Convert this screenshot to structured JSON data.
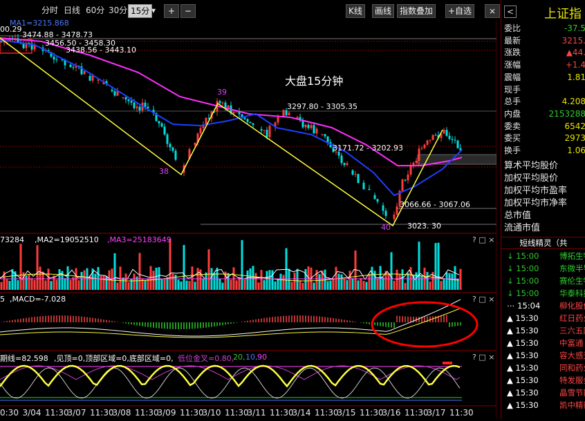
{
  "toolbar": {
    "tabs": [
      "分时",
      "日线",
      "60分",
      "30分",
      "15分"
    ],
    "active_tab": "15分",
    "dropdown_arrow": "▾",
    "zoom_in": "+",
    "zoom_out": "−",
    "right_buttons": [
      "K线",
      "画线",
      "指数叠加",
      "+自选"
    ],
    "close_label": "⨯"
  },
  "main_chart": {
    "ma_label": "MA1=3215.868",
    "annotation_title": "大盘15分钟",
    "labels": {
      "price_tl": "00.29",
      "r1": "3474.88 - 3478.73",
      "r2": "3456.50 - 3458.30",
      "r3": "3438.56 - 3443.10",
      "r4": "3297.80 - 3305.35",
      "r5": "3171.72 - 3202.93",
      "r6": "3066.66 - 3067.06",
      "r7": "3023. 30",
      "w38": "38",
      "w39": "39",
      "w40": "40"
    }
  },
  "volume_panel": {
    "label_ma1": "73284",
    "label_ma2": ",MA2=19052510",
    "label_ma3": ",MA3=25183649",
    "controls": "? □ ×"
  },
  "macd_panel": {
    "label_prefix": "5",
    "label_macd": ",MACD=-7.028",
    "controls": "? □ ×"
  },
  "kdj_panel": {
    "label_main": "期线=82.598",
    "label_flags": ",见顶=0,顶部区域=0,底部区域=0,",
    "label_low": "低位金叉=0.80,",
    "label_20": "20,",
    "label_10": "10,",
    "label_90": "90",
    "controls": "? □ ×"
  },
  "x_axis": [
    "0:30",
    "3/04",
    "11:30",
    "3/07",
    "11:30",
    "3/08",
    "11:30",
    "3/09",
    "11:30",
    "3/10",
    "11:30",
    "3/11",
    "11:30",
    "3/14",
    "11:30",
    "3/15",
    "11:30",
    "3/16",
    "11:30",
    "3/17",
    "11:30"
  ],
  "right_panel": {
    "back_icon_char": "<",
    "title": "上证指",
    "quote_rows": [
      {
        "k": "委比",
        "v": "-37.5",
        "color": "#2ecc2e"
      },
      {
        "k": "最新",
        "v": "3215.",
        "color": "#ff4444"
      },
      {
        "k": "涨跌",
        "v": "▲44.",
        "color": "#ff4444"
      },
      {
        "k": "涨幅",
        "v": "+1.4",
        "color": "#ff4444"
      },
      {
        "k": "震幅",
        "v": "1.81",
        "color": "#e6e600"
      },
      {
        "k": "现手",
        "v": "",
        "color": "#e6e6e6"
      },
      {
        "k": "总手",
        "v": "4.208",
        "color": "#e6e600"
      },
      {
        "k": "内盘",
        "v": "2153288",
        "color": "#2ecc2e"
      },
      {
        "k": "委卖",
        "v": "6542",
        "color": "#e6e600"
      },
      {
        "k": "委买",
        "v": "2973",
        "color": "#e6e600"
      },
      {
        "k": "换手",
        "v": "1.06",
        "color": "#e6e600"
      }
    ],
    "info_rows": [
      "算术平均股价",
      "加权平均股价",
      "加权平均市盈率",
      "加权平均市净率",
      "总市值",
      "流通市值"
    ],
    "feed_header": "短线精灵（共",
    "feed": [
      {
        "dir": "↓",
        "time": "15:00",
        "name": "博拓生物",
        "color": "#2ecc2e"
      },
      {
        "dir": "↓",
        "time": "15:00",
        "name": "东微半导",
        "color": "#2ecc2e"
      },
      {
        "dir": "↓",
        "time": "15:00",
        "name": "赛伦生物",
        "color": "#2ecc2e"
      },
      {
        "dir": "↓",
        "time": "15:00",
        "name": "华泰科技",
        "color": "#2ecc2e"
      },
      {
        "dir": "⋯",
        "time": "15:04",
        "name": "柳化股份",
        "color": "#ff4444"
      },
      {
        "dir": "▲",
        "time": "15:30",
        "name": "红日药业",
        "color": "#ff4444"
      },
      {
        "dir": "▲",
        "time": "15:30",
        "name": "三六五网",
        "color": "#ff4444"
      },
      {
        "dir": "▲",
        "time": "15:30",
        "name": "中富通",
        "color": "#ff4444"
      },
      {
        "dir": "▲",
        "time": "15:30",
        "name": "容大感光",
        "color": "#ff4444"
      },
      {
        "dir": "▲",
        "time": "15:30",
        "name": "同和药业",
        "color": "#ff4444"
      },
      {
        "dir": "▲",
        "time": "15:30",
        "name": "特发服务",
        "color": "#ff4444"
      },
      {
        "dir": "▲",
        "time": "15:30",
        "name": "晶雪节能",
        "color": "#ff4444"
      },
      {
        "dir": "▲",
        "time": "15:30",
        "name": "凯中精密",
        "color": "#ff4444"
      }
    ]
  },
  "colors": {
    "up": "#ff3c3c",
    "down": "#00e0e0",
    "ma1": "#ffffff",
    "ma2": "#1f3fff",
    "ma3": "#ff2fff",
    "trend": "#ffff40",
    "circle": "#ff0000",
    "grid": "#8a0000"
  }
}
